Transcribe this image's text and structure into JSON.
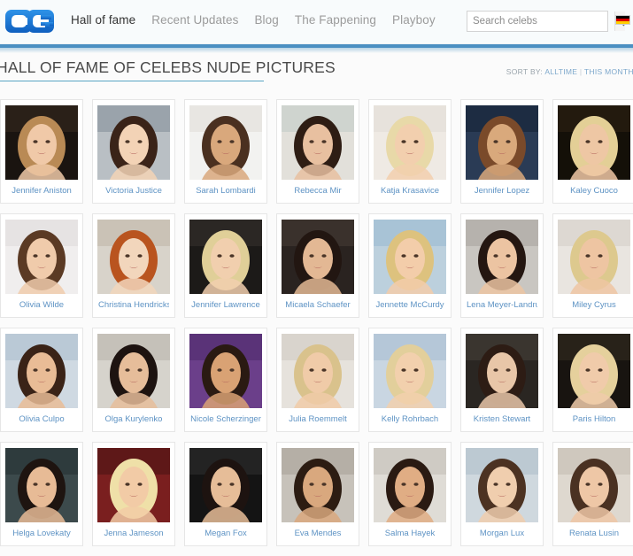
{
  "header": {
    "logo_text": "CG",
    "logo_color": "#1f7fd6",
    "nav": [
      {
        "label": "Hall of fame",
        "active": true
      },
      {
        "label": "Recent Updates",
        "active": false
      },
      {
        "label": "Blog",
        "active": false
      },
      {
        "label": "The Fappening",
        "active": false
      },
      {
        "label": "Playboy",
        "active": false
      }
    ],
    "search": {
      "placeholder": "Search celebs",
      "value": "",
      "button_icon": "search-icon"
    },
    "flag": {
      "name": "german-flag-icon",
      "bands": [
        "#000000",
        "#dd0000",
        "#ffce00"
      ]
    },
    "accent_bar_color": "#4b90c2"
  },
  "page": {
    "title": "HALL OF FAME OF CELEBS NUDE PICTURES",
    "underline_color": "#59a5c4",
    "sort": {
      "label": "SORT BY:",
      "options": [
        "ALLTIME",
        "THIS MONTH"
      ],
      "separator": "|",
      "trailing_separator": "|"
    }
  },
  "grid": {
    "cards": [
      {
        "name": "Jennifer Aniston",
        "hair": "#b98a55",
        "skin": "#f0c9a8",
        "bg": "#1a1410",
        "top": "#2a2018"
      },
      {
        "name": "Victoria Justice",
        "hair": "#3a2318",
        "skin": "#f3d3b6",
        "bg": "#b9bfc4",
        "top": "#9aa3ab"
      },
      {
        "name": "Sarah Lombardi",
        "hair": "#4a3020",
        "skin": "#d9a87c",
        "bg": "#f2f2f0",
        "top": "#e8e6e2"
      },
      {
        "name": "Rebecca Mir",
        "hair": "#2e1d14",
        "skin": "#e8c0a0",
        "bg": "#e2e0da",
        "top": "#cfd4cf"
      },
      {
        "name": "Katja Krasavice",
        "hair": "#e8d9a8",
        "skin": "#f2cfae",
        "bg": "#efeae4",
        "top": "#e7e2dc"
      },
      {
        "name": "Jennifer Lopez",
        "hair": "#7a4a2a",
        "skin": "#d9a97c",
        "bg": "#2a3b55",
        "top": "#1d2c42"
      },
      {
        "name": "Kaley Cuoco",
        "hair": "#e3cf96",
        "skin": "#eec7a4",
        "bg": "#141008",
        "top": "#231a0e"
      },
      {
        "name": "Olivia Wilde",
        "hair": "#5b3a24",
        "skin": "#f0cbab",
        "bg": "#f0eeee",
        "top": "#e6e3e3"
      },
      {
        "name": "Christina Hendricks",
        "hair": "#b9541f",
        "skin": "#f2d6bc",
        "bg": "#d8d3ca",
        "top": "#cac2b6"
      },
      {
        "name": "Jennifer Lawrence",
        "hair": "#e0cf98",
        "skin": "#f1cfae",
        "bg": "#1c1a18",
        "top": "#2b2724"
      },
      {
        "name": "Micaela Schaefer",
        "hair": "#221611",
        "skin": "#e3b894",
        "bg": "#2a2320",
        "top": "#3a312c"
      },
      {
        "name": "Jennette McCurdy",
        "hair": "#ddc27e",
        "skin": "#f3cdaa",
        "bg": "#bcd0dd",
        "top": "#a8c3d6"
      },
      {
        "name": "Lena Meyer-Landrut",
        "hair": "#241611",
        "skin": "#ecc4a2",
        "bg": "#c9c6c1",
        "top": "#b6b2ad"
      },
      {
        "name": "Miley Cyrus",
        "hair": "#ddc98e",
        "skin": "#eec5a2",
        "bg": "#e9e5e0",
        "top": "#ddd8d2"
      },
      {
        "name": "Olivia Culpo",
        "hair": "#3a2317",
        "skin": "#e9bc96",
        "bg": "#cfd9e2",
        "top": "#bac9d6"
      },
      {
        "name": "Olga Kurylenko",
        "hair": "#1d1310",
        "skin": "#e6bd9a",
        "bg": "#d6d3cc",
        "top": "#c5c1b9"
      },
      {
        "name": "Nicole Scherzinger",
        "hair": "#2a1a12",
        "skin": "#d9a274",
        "bg": "#6b3f8a",
        "top": "#5a3378"
      },
      {
        "name": "Julia Roemmelt",
        "hair": "#d9c28c",
        "skin": "#f0cba8",
        "bg": "#e6e2dc",
        "top": "#d9d4cd"
      },
      {
        "name": "Kelly Rohrbach",
        "hair": "#e2cf9b",
        "skin": "#f2d0ad",
        "bg": "#c9d6e2",
        "top": "#b5c7d8"
      },
      {
        "name": "Kristen Stewart",
        "hair": "#2d1c14",
        "skin": "#e8c6a8",
        "bg": "#2a2622",
        "top": "#3a352f"
      },
      {
        "name": "Paris Hilton",
        "hair": "#e5d09c",
        "skin": "#f0cbaa",
        "bg": "#181410",
        "top": "#282219"
      },
      {
        "name": "Helga Lovekaty",
        "hair": "#1e1410",
        "skin": "#e7bb96",
        "bg": "#3c4a4c",
        "top": "#2e3b3d"
      },
      {
        "name": "Jenna Jameson",
        "hair": "#efe0a8",
        "skin": "#f2cba6",
        "bg": "#7a1f1f",
        "top": "#5e1818"
      },
      {
        "name": "Megan Fox",
        "hair": "#1d1310",
        "skin": "#e6bd98",
        "bg": "#141414",
        "top": "#232323"
      },
      {
        "name": "Eva Mendes",
        "hair": "#2c1c12",
        "skin": "#d9a87e",
        "bg": "#c7c2ba",
        "top": "#b5afa6"
      },
      {
        "name": "Salma Hayek",
        "hair": "#2a1a12",
        "skin": "#e0ad84",
        "bg": "#dfdcd6",
        "top": "#cfcbc4"
      },
      {
        "name": "Morgan Lux",
        "hair": "#4c3222",
        "skin": "#f0ceae",
        "bg": "#cfd8de",
        "top": "#bcc9d2"
      },
      {
        "name": "Renata Lusin",
        "hair": "#4a3122",
        "skin": "#eec7a6",
        "bg": "#ded8cf",
        "top": "#cfc8be"
      }
    ]
  }
}
